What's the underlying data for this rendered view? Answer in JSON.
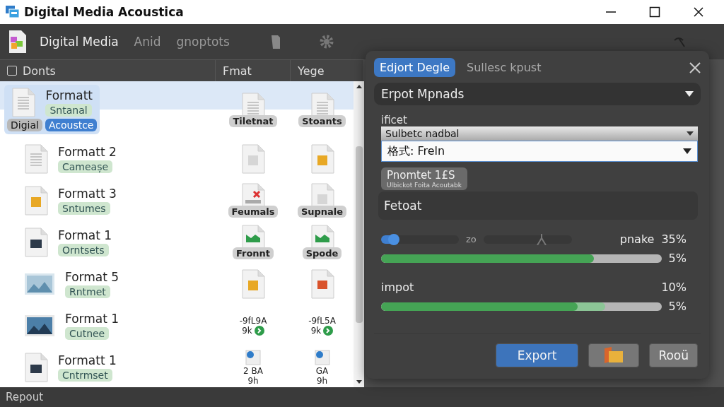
{
  "window": {
    "title": "Digital Media Acoustica"
  },
  "toolbar": {
    "items": [
      {
        "label": "Digital Media",
        "selected": true
      },
      {
        "label": "Anid",
        "selected": false
      },
      {
        "label": "gnoptots",
        "selected": false
      }
    ]
  },
  "table": {
    "columns": [
      "Donts",
      "Fmat",
      "Yege"
    ],
    "select_all": {
      "checked": false
    },
    "rows": [
      {
        "selected": true,
        "kind": "doc",
        "title": "Formatt",
        "tag": "Sntanal",
        "chips": [
          {
            "label": "Digial",
            "selected": false
          },
          {
            "label": "Acoustce",
            "selected": true
          }
        ],
        "cells": [
          {
            "kind": "doc",
            "label": "Tiletnat"
          },
          {
            "kind": "doc",
            "label": "Stoants"
          }
        ]
      },
      {
        "selected": false,
        "kind": "doc",
        "title": "Formatt 2",
        "tag": "Cameașe",
        "cells": [
          {
            "kind": "blank"
          },
          {
            "kind": "orange"
          }
        ]
      },
      {
        "selected": false,
        "kind": "orange",
        "title": "Formatt 3",
        "tag": "Sntumes",
        "cells": [
          {
            "kind": "xmark",
            "label": "Feumals"
          },
          {
            "kind": "blank",
            "label": "Supnale"
          }
        ]
      },
      {
        "selected": false,
        "kind": "dark",
        "title": "Format 1",
        "tag": "Orntsets",
        "cells": [
          {
            "kind": "flag",
            "label": "Fronnt"
          },
          {
            "kind": "flag",
            "label": "Spode"
          }
        ]
      },
      {
        "selected": false,
        "kind": "panorama",
        "title": "Format 5",
        "tag": "Rntmet",
        "cells": [
          {
            "kind": "orange"
          },
          {
            "kind": "red"
          }
        ]
      },
      {
        "selected": false,
        "kind": "mountain",
        "title": "Format 1",
        "tag": "Cutnee",
        "cells": [
          {
            "kind": "check",
            "lines": [
              "-9fL9A",
              "9k"
            ]
          },
          {
            "kind": "check",
            "lines": [
              "-9fL5A",
              "9k"
            ]
          }
        ]
      },
      {
        "selected": false,
        "kind": "dark",
        "title": "Formatt 1",
        "tag": "Cntrmset",
        "cells": [
          {
            "kind": "share",
            "lines": [
              "2 BA",
              "9h"
            ]
          },
          {
            "kind": "share",
            "lines": [
              "GA",
              "9h"
            ]
          }
        ]
      }
    ]
  },
  "dialog": {
    "tabs": [
      {
        "label": "Edjort Degle",
        "selected": true
      },
      {
        "label": "Sullesc kpust",
        "selected": false
      }
    ],
    "preset": "Erpot Mpnads",
    "label": "ificet",
    "select_1": "Sulbetc nadbal",
    "select_2": "格式: Freln",
    "chip": {
      "title": "Pnomtet 1£S",
      "subtitle": "Ulbickot Foita Acoutabk"
    },
    "field": "Fetoat",
    "slider_1": {
      "level": 0.16
    },
    "slider_reading": "zo",
    "slider_2": {
      "level": 0.66
    },
    "make_label": "pnake",
    "make_value": "35%",
    "progress_1": {
      "level": 0.76,
      "reading": "5%"
    },
    "input_label": "impot",
    "input_value": "10%",
    "progress_2": {
      "level": 0.7,
      "reading": "5%"
    },
    "buttons": [
      {
        "kind": "primary",
        "label": "Export"
      },
      {
        "kind": "icon"
      },
      {
        "kind": "plain",
        "label": "Rooü"
      }
    ]
  },
  "status_bar": "Repout"
}
